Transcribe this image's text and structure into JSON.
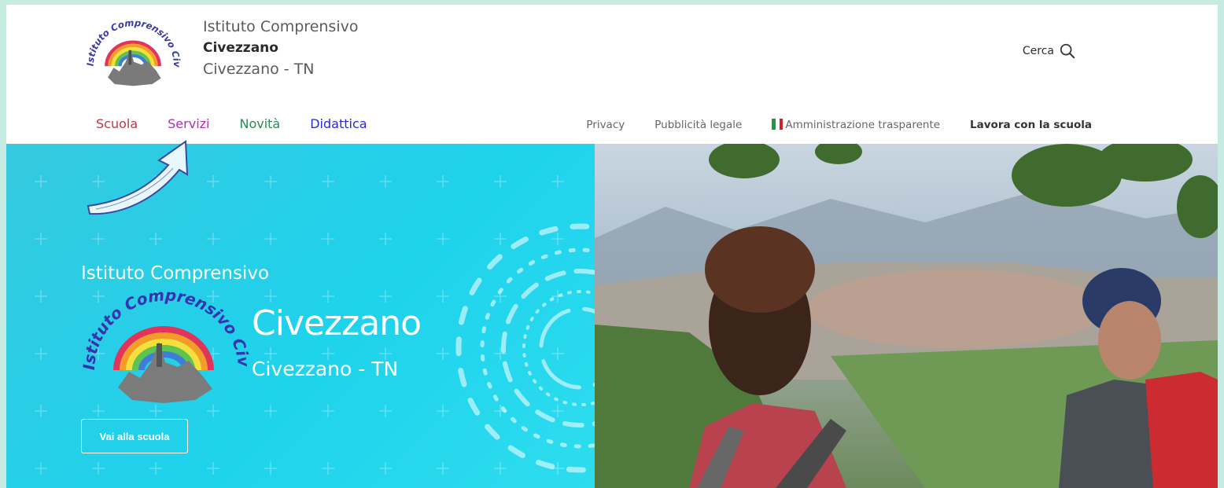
{
  "header": {
    "school_line1": "Istituto Comprensivo",
    "school_line2": "Civezzano",
    "school_line3": "Civezzano - TN",
    "search_label": "Cerca",
    "search_icon": "search-icon"
  },
  "main_nav": [
    {
      "label": "Scuola",
      "color": "#c0364a"
    },
    {
      "label": "Servizi",
      "color": "#b22fb0"
    },
    {
      "label": "Novità",
      "color": "#2b8a55"
    },
    {
      "label": "Didattica",
      "color": "#2a2ad8"
    }
  ],
  "secondary_nav": {
    "privacy": "Privacy",
    "pubblicita": "Pubblicità legale",
    "amministrazione": "Amministrazione trasparente",
    "lavora": "Lavora con la scuola",
    "flag_colors": [
      "#1e9b3f",
      "#ffffff",
      "#d3202a"
    ]
  },
  "hero": {
    "title1": "Istituto Comprensivo",
    "title2": "Civezzano",
    "title3": "Civezzano - TN",
    "button_label": "Vai alla scuola",
    "panel_color": "#2fd1e6"
  },
  "logo_text": "Istituto Comprensivo Civezzano"
}
